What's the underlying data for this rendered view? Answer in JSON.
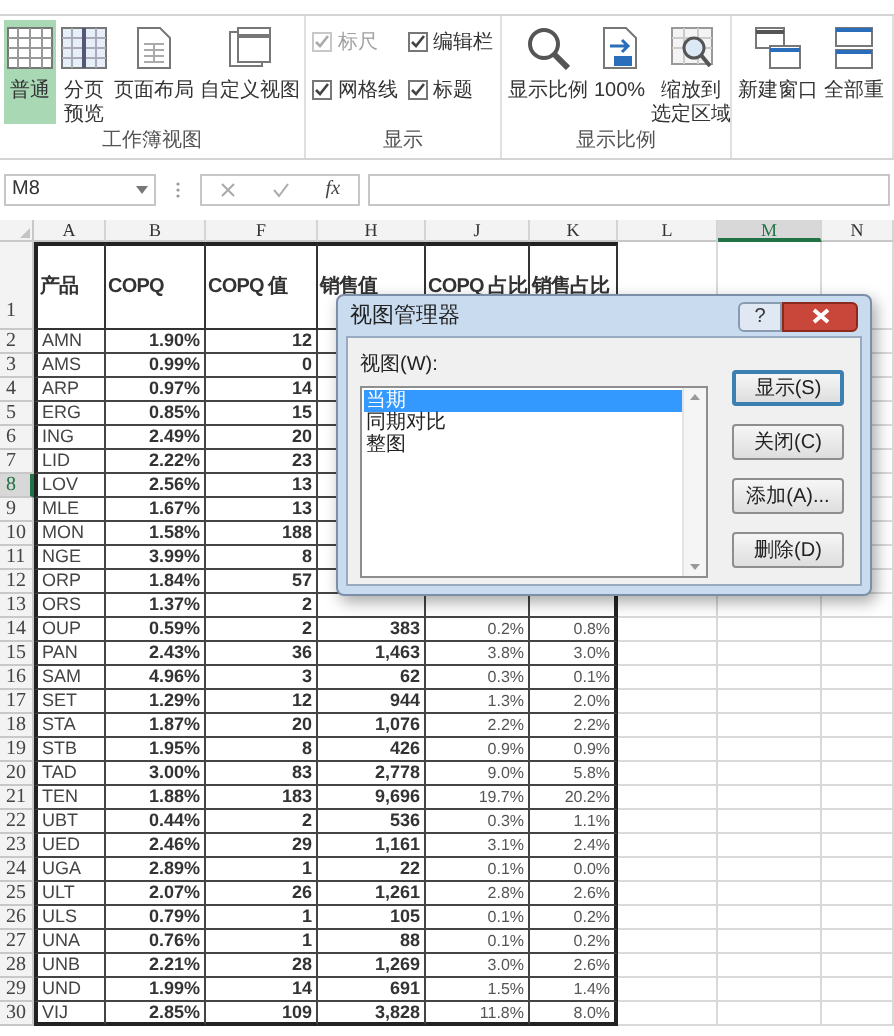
{
  "ribbon": {
    "groups": [
      {
        "label": "工作簿视图",
        "items": [
          {
            "kind": "normal",
            "label": "普通",
            "selected": true
          },
          {
            "kind": "pagebreak",
            "lines": [
              "分页",
              "预览"
            ],
            "selected": false
          },
          {
            "kind": "layout",
            "label": "页面布局",
            "selected": false
          },
          {
            "kind": "custom",
            "label": "自定义视图",
            "selected": false
          }
        ]
      },
      {
        "label": "显示",
        "items": [
          {
            "kind": "checkbox",
            "label": "标尺",
            "checked": true,
            "disabled": true
          },
          {
            "kind": "checkbox",
            "label": "编辑栏",
            "checked": true,
            "disabled": false
          },
          {
            "kind": "checkbox",
            "label": "网格线",
            "checked": true,
            "disabled": false
          },
          {
            "kind": "checkbox",
            "label": "标题",
            "checked": true,
            "disabled": false
          }
        ]
      },
      {
        "label": "显示比例",
        "items": [
          {
            "kind": "zoom",
            "label": "显示比例",
            "selected": false
          },
          {
            "kind": "hundred",
            "label": "100%",
            "selected": false
          },
          {
            "kind": "fit",
            "lines": [
              "缩放到",
              "选定区域"
            ],
            "selected": false
          }
        ]
      },
      {
        "items": [
          {
            "kind": "newwindow",
            "label": "新建窗口",
            "selected": false
          },
          {
            "kind": "arrange",
            "label": "全部重",
            "selected": false
          }
        ]
      }
    ]
  },
  "formula_bar": {
    "name_box": "M8",
    "function_label": "fx"
  },
  "sheet": {
    "columns": [
      {
        "label": "A",
        "selected": false
      },
      {
        "label": "B",
        "selected": false
      },
      {
        "label": "F",
        "selected": false
      },
      {
        "label": "H",
        "selected": false
      },
      {
        "label": "J",
        "selected": false
      },
      {
        "label": "K",
        "selected": false
      },
      {
        "label": "L",
        "selected": false
      },
      {
        "label": "M",
        "selected": true
      },
      {
        "label": "N",
        "selected": false
      }
    ],
    "header_row": {
      "row": "1",
      "cells": [
        "产品",
        "COPQ",
        "COPQ 值",
        "销售值",
        "COPQ 占比",
        "销售占比"
      ]
    },
    "rows": [
      {
        "row": "2",
        "selected": false,
        "cells": [
          "AMN",
          "1.90%",
          "12"
        ]
      },
      {
        "row": "3",
        "selected": false,
        "cells": [
          "AMS",
          "0.99%",
          "0"
        ]
      },
      {
        "row": "4",
        "selected": false,
        "cells": [
          "ARP",
          "0.97%",
          "14"
        ]
      },
      {
        "row": "5",
        "selected": false,
        "cells": [
          "ERG",
          "0.85%",
          "15"
        ]
      },
      {
        "row": "6",
        "selected": false,
        "cells": [
          "ING",
          "2.49%",
          "20"
        ]
      },
      {
        "row": "7",
        "selected": false,
        "cells": [
          "LID",
          "2.22%",
          "23"
        ]
      },
      {
        "row": "8",
        "selected": true,
        "cells": [
          "LOV",
          "2.56%",
          "13"
        ]
      },
      {
        "row": "9",
        "selected": false,
        "cells": [
          "MLE",
          "1.67%",
          "13"
        ]
      },
      {
        "row": "10",
        "selected": false,
        "cells": [
          "MON",
          "1.58%",
          "188"
        ]
      },
      {
        "row": "11",
        "selected": false,
        "cells": [
          "NGE",
          "3.99%",
          "8"
        ]
      },
      {
        "row": "12",
        "selected": false,
        "cells": [
          "ORP",
          "1.84%",
          "57"
        ]
      },
      {
        "row": "13",
        "selected": false,
        "cells": [
          "ORS",
          "1.37%",
          "2"
        ]
      },
      {
        "row": "14",
        "selected": false,
        "cells": [
          "OUP",
          "0.59%",
          "2",
          "383",
          "0.2%",
          "0.8%"
        ]
      },
      {
        "row": "15",
        "selected": false,
        "cells": [
          "PAN",
          "2.43%",
          "36",
          "1,463",
          "3.8%",
          "3.0%"
        ]
      },
      {
        "row": "16",
        "selected": false,
        "cells": [
          "SAM",
          "4.96%",
          "3",
          "62",
          "0.3%",
          "0.1%"
        ]
      },
      {
        "row": "17",
        "selected": false,
        "cells": [
          "SET",
          "1.29%",
          "12",
          "944",
          "1.3%",
          "2.0%"
        ]
      },
      {
        "row": "18",
        "selected": false,
        "cells": [
          "STA",
          "1.87%",
          "20",
          "1,076",
          "2.2%",
          "2.2%"
        ]
      },
      {
        "row": "19",
        "selected": false,
        "cells": [
          "STB",
          "1.95%",
          "8",
          "426",
          "0.9%",
          "0.9%"
        ]
      },
      {
        "row": "20",
        "selected": false,
        "cells": [
          "TAD",
          "3.00%",
          "83",
          "2,778",
          "9.0%",
          "5.8%"
        ]
      },
      {
        "row": "21",
        "selected": false,
        "cells": [
          "TEN",
          "1.88%",
          "183",
          "9,696",
          "19.7%",
          "20.2%"
        ]
      },
      {
        "row": "22",
        "selected": false,
        "cells": [
          "UBT",
          "0.44%",
          "2",
          "536",
          "0.3%",
          "1.1%"
        ]
      },
      {
        "row": "23",
        "selected": false,
        "cells": [
          "UED",
          "2.46%",
          "29",
          "1,161",
          "3.1%",
          "2.4%"
        ]
      },
      {
        "row": "24",
        "selected": false,
        "cells": [
          "UGA",
          "2.89%",
          "1",
          "22",
          "0.1%",
          "0.0%"
        ]
      },
      {
        "row": "25",
        "selected": false,
        "cells": [
          "ULT",
          "2.07%",
          "26",
          "1,261",
          "2.8%",
          "2.6%"
        ]
      },
      {
        "row": "26",
        "selected": false,
        "cells": [
          "ULS",
          "0.79%",
          "1",
          "105",
          "0.1%",
          "0.2%"
        ]
      },
      {
        "row": "27",
        "selected": false,
        "cells": [
          "UNA",
          "0.76%",
          "1",
          "88",
          "0.1%",
          "0.2%"
        ]
      },
      {
        "row": "28",
        "selected": false,
        "cells": [
          "UNB",
          "2.21%",
          "28",
          "1,269",
          "3.0%",
          "2.6%"
        ]
      },
      {
        "row": "29",
        "selected": false,
        "cells": [
          "UND",
          "1.99%",
          "14",
          "691",
          "1.5%",
          "1.4%"
        ]
      },
      {
        "row": "30",
        "selected": false,
        "cells": [
          "VIJ",
          "2.85%",
          "109",
          "3,828",
          "11.8%",
          "8.0%"
        ]
      }
    ]
  },
  "dialog": {
    "title": "视图管理器",
    "help": "?",
    "list_label": "视图(W):",
    "views": [
      {
        "label": "当期",
        "selected": true
      },
      {
        "label": "同期对比",
        "selected": false
      },
      {
        "label": "整图",
        "selected": false
      }
    ],
    "buttons": [
      {
        "label": "显示(S)",
        "default": true
      },
      {
        "label": "关闭(C)",
        "default": false
      },
      {
        "label": "添加(A)...",
        "default": false
      },
      {
        "label": "删除(D)",
        "default": false
      }
    ]
  }
}
